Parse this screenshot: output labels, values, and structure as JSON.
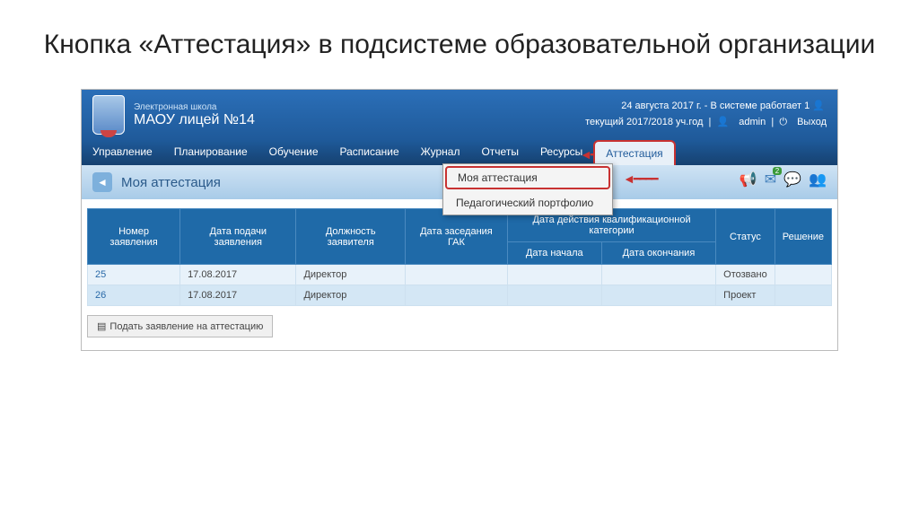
{
  "slide": {
    "title": "Кнопка «Аттестация» в подсистеме образовательной организации"
  },
  "header": {
    "subtitle": "Электронная школа",
    "title": "МАОУ лицей №14",
    "date_line": "24 августа 2017 г. - В системе работает 1",
    "year_line": "текущий 2017/2018 уч.год",
    "admin": "admin",
    "logout": "Выход"
  },
  "nav": {
    "items": [
      "Управление",
      "Планирование",
      "Обучение",
      "Расписание",
      "Журнал",
      "Отчеты",
      "Ресурсы",
      "Аттестация"
    ]
  },
  "dropdown": {
    "item1": "Моя аттестация",
    "item2": "Педагогический портфолио"
  },
  "page": {
    "title": "Моя аттестация"
  },
  "table": {
    "headers": {
      "num": "Номер заявления",
      "date": "Дата подачи заявления",
      "position": "Должность заявителя",
      "gak": "Дата заседания ГАК",
      "period": "Дата действия квалификационной категории",
      "start": "Дата начала",
      "end": "Дата окончания",
      "status": "Статус",
      "decision": "Решение"
    },
    "rows": [
      {
        "num": "25",
        "date": "17.08.2017",
        "position": "Директор",
        "gak": "",
        "start": "",
        "end": "",
        "status": "Отозвано",
        "decision": ""
      },
      {
        "num": "26",
        "date": "17.08.2017",
        "position": "Директор",
        "gak": "",
        "start": "",
        "end": "",
        "status": "Проект",
        "decision": ""
      }
    ]
  },
  "button": {
    "submit": "Подать заявление на аттестацию"
  },
  "notification_count": "2"
}
